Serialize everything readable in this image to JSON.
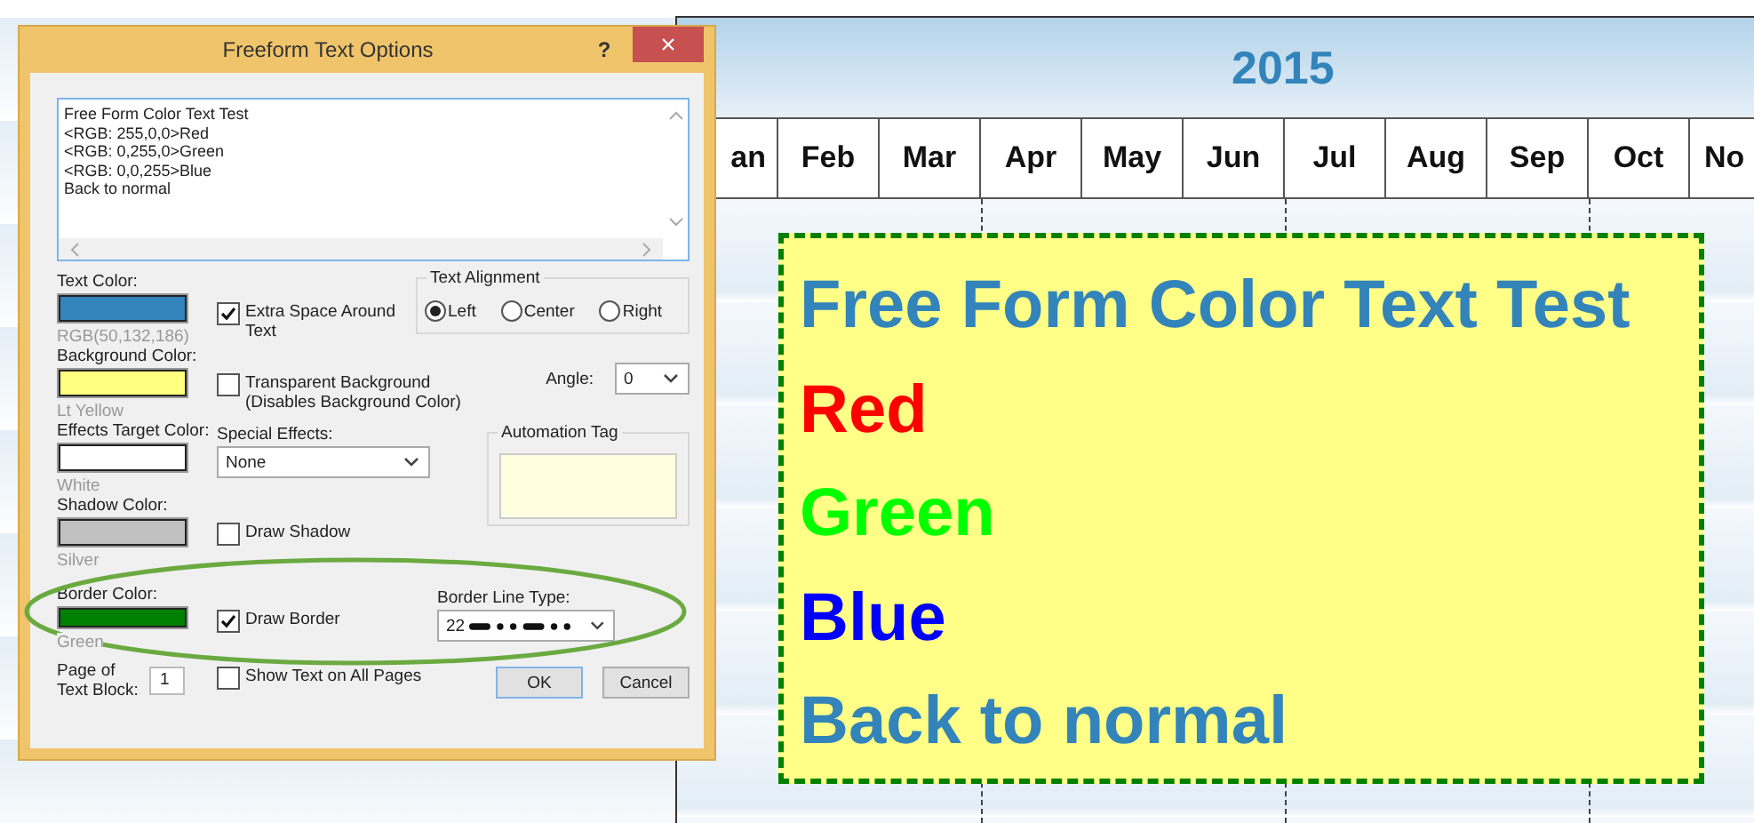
{
  "chart": {
    "year": "2015",
    "months": [
      "an",
      "Feb",
      "Mar",
      "Apr",
      "May",
      "Jun",
      "Jul",
      "Aug",
      "Sep",
      "Oct",
      "No"
    ],
    "text_box": {
      "lines": [
        {
          "text": "Free Form Color Text Test",
          "color": "#3284ba"
        },
        {
          "text": "Red",
          "color": "#ff0000"
        },
        {
          "text": "Green",
          "color": "#00ff00"
        },
        {
          "text": "Blue",
          "color": "#0000ff"
        },
        {
          "text": "Back to normal",
          "color": "#3284ba"
        }
      ]
    }
  },
  "dialog": {
    "title": "Freeform Text Options",
    "help": "?",
    "close": "×",
    "text_lines": [
      "Free Form Color Text Test",
      "<RGB: 255,0,0>Red",
      "<RGB: 0,255,0>Green",
      "<RGB: 0,0,255>Blue",
      "Back to normal"
    ],
    "text_color": {
      "label": "Text Color:",
      "color": "#3284ba",
      "caption": "RGB(50,132,186)"
    },
    "extra_space": {
      "label": "Extra Space Around Text",
      "checked": true
    },
    "text_alignment": {
      "label": "Text Alignment",
      "options": [
        {
          "label": "Left",
          "selected": true
        },
        {
          "label": "Center",
          "selected": false
        },
        {
          "label": "Right",
          "selected": false
        }
      ]
    },
    "background_color": {
      "label": "Background Color:",
      "color": "#ffff80",
      "caption": "Lt Yellow"
    },
    "transparent_background": {
      "label": "Transparent Background",
      "note": "(Disables Background Color)",
      "checked": false
    },
    "angle": {
      "label": "Angle:",
      "value": "0"
    },
    "effects_target_color": {
      "label": "Effects Target Color:",
      "color": "#ffffff",
      "caption": "White"
    },
    "special_effects": {
      "label": "Special Effects:",
      "value": "None"
    },
    "automation_tag": {
      "label": "Automation Tag"
    },
    "shadow_color": {
      "label": "Shadow Color:",
      "color": "#c0c0c0",
      "caption": "Silver"
    },
    "draw_shadow": {
      "label": "Draw Shadow",
      "checked": false
    },
    "border_color": {
      "label": "Border Color:",
      "color": "#008000",
      "caption": "Green"
    },
    "draw_border": {
      "label": "Draw Border",
      "checked": true
    },
    "border_line_type": {
      "label": "Border Line Type:",
      "value": "22"
    },
    "page_of_text_block": {
      "label": "Page of Text Block:",
      "value": "1"
    },
    "show_text_all_pages": {
      "label": "Show Text on All Pages",
      "checked": false
    },
    "buttons": [
      "OK",
      "Cancel"
    ]
  }
}
